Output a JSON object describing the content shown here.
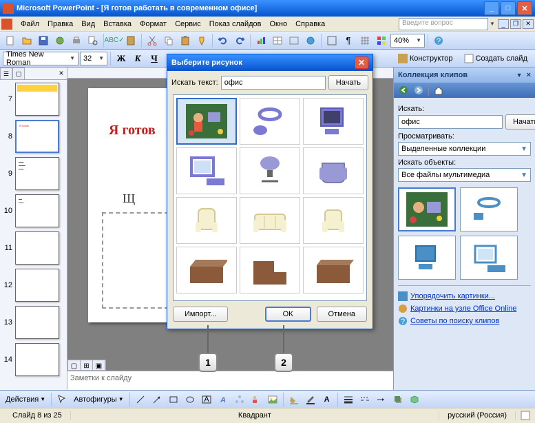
{
  "titlebar": {
    "app": "Microsoft PowerPoint",
    "doc": "[Я готов работать в современном офисе]"
  },
  "menu": {
    "file": "Файл",
    "edit": "Правка",
    "view": "Вид",
    "insert": "Вставка",
    "format": "Формат",
    "tools": "Сервис",
    "slideshow": "Показ слайдов",
    "window": "Окно",
    "help": "Справка",
    "helpbox": "Введите вопрос"
  },
  "toolbar": {
    "zoom": "40%"
  },
  "format": {
    "font": "Times New Roman",
    "size": "32",
    "bold": "Ж",
    "italic": "К",
    "underline": "Ч",
    "designer": "Конструктор",
    "newslide": "Создать слайд"
  },
  "slides": {
    "nums": [
      "7",
      "8",
      "9",
      "10",
      "11",
      "12",
      "13",
      "14"
    ],
    "active": 1,
    "title": "Я готов",
    "sub": "Щ",
    "notes": "Заметки к слайду"
  },
  "dialog": {
    "title": "Выберите рисунок",
    "searchLabel": "Искать текст:",
    "searchValue": "офис",
    "searchBtn": "Начать",
    "import": "Импорт...",
    "ok": "OК",
    "cancel": "Отмена"
  },
  "taskpane": {
    "title": "Коллекция клипов",
    "searchLabel": "Искать:",
    "searchValue": "офис",
    "searchBtn": "Начать",
    "browseLabel": "Просматривать:",
    "browseValue": "Выделенные коллекции",
    "objLabel": "Искать объекты:",
    "objValue": "Все файлы мультимедиа",
    "link1": "Упорядочить картинки...",
    "link2": "Картинки на узле Office Online",
    "link3": "Советы по поиску клипов"
  },
  "drawbar": {
    "actions": "Действия",
    "autoshapes": "Автофигуры"
  },
  "status": {
    "slide": "Слайд 8 из 25",
    "layout": "Квадрант",
    "lang": "русский (Россия)"
  },
  "callouts": {
    "c1": "1",
    "c2": "2"
  }
}
